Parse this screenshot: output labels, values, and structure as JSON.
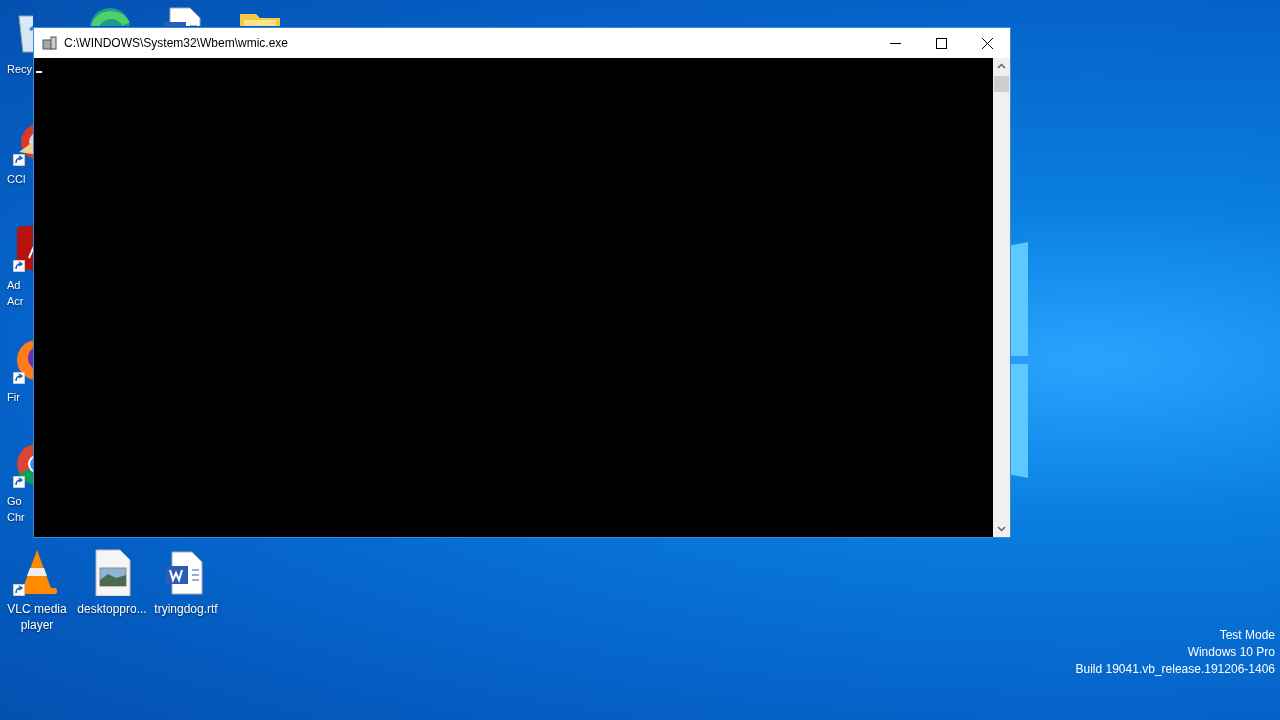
{
  "desktop_icons": [
    {
      "kind": "recycle-bin",
      "lines": [
        "Recy"
      ]
    },
    {
      "kind": "browser-round"
    },
    {
      "kind": "word-doc"
    },
    {
      "kind": "folder"
    },
    {
      "kind": "cleaner",
      "lines": [
        "CCl"
      ],
      "shortcut": true
    },
    {
      "kind": "pdf-app",
      "lines": [
        "Ad",
        "Acr"
      ],
      "shortcut": true
    },
    {
      "kind": "fox-browser",
      "lines": [
        "Fir"
      ],
      "shortcut": true
    },
    {
      "kind": "chrome-like",
      "lines": [
        "Go",
        "Chr"
      ],
      "shortcut": true
    },
    {
      "kind": "cone",
      "lines": [
        "VLC media",
        "player"
      ],
      "shortcut": true
    },
    {
      "kind": "image-file",
      "lines": [
        "desktoppro..."
      ]
    },
    {
      "kind": "word-doc",
      "lines": [
        "tryingdog.rtf"
      ]
    }
  ],
  "window": {
    "title": "C:\\WINDOWS\\System32\\Wbem\\wmic.exe"
  },
  "desktop_info": [
    "Test Mode",
    "Windows 10 Pro",
    "Build 19041.vb_release.191206-1406"
  ]
}
